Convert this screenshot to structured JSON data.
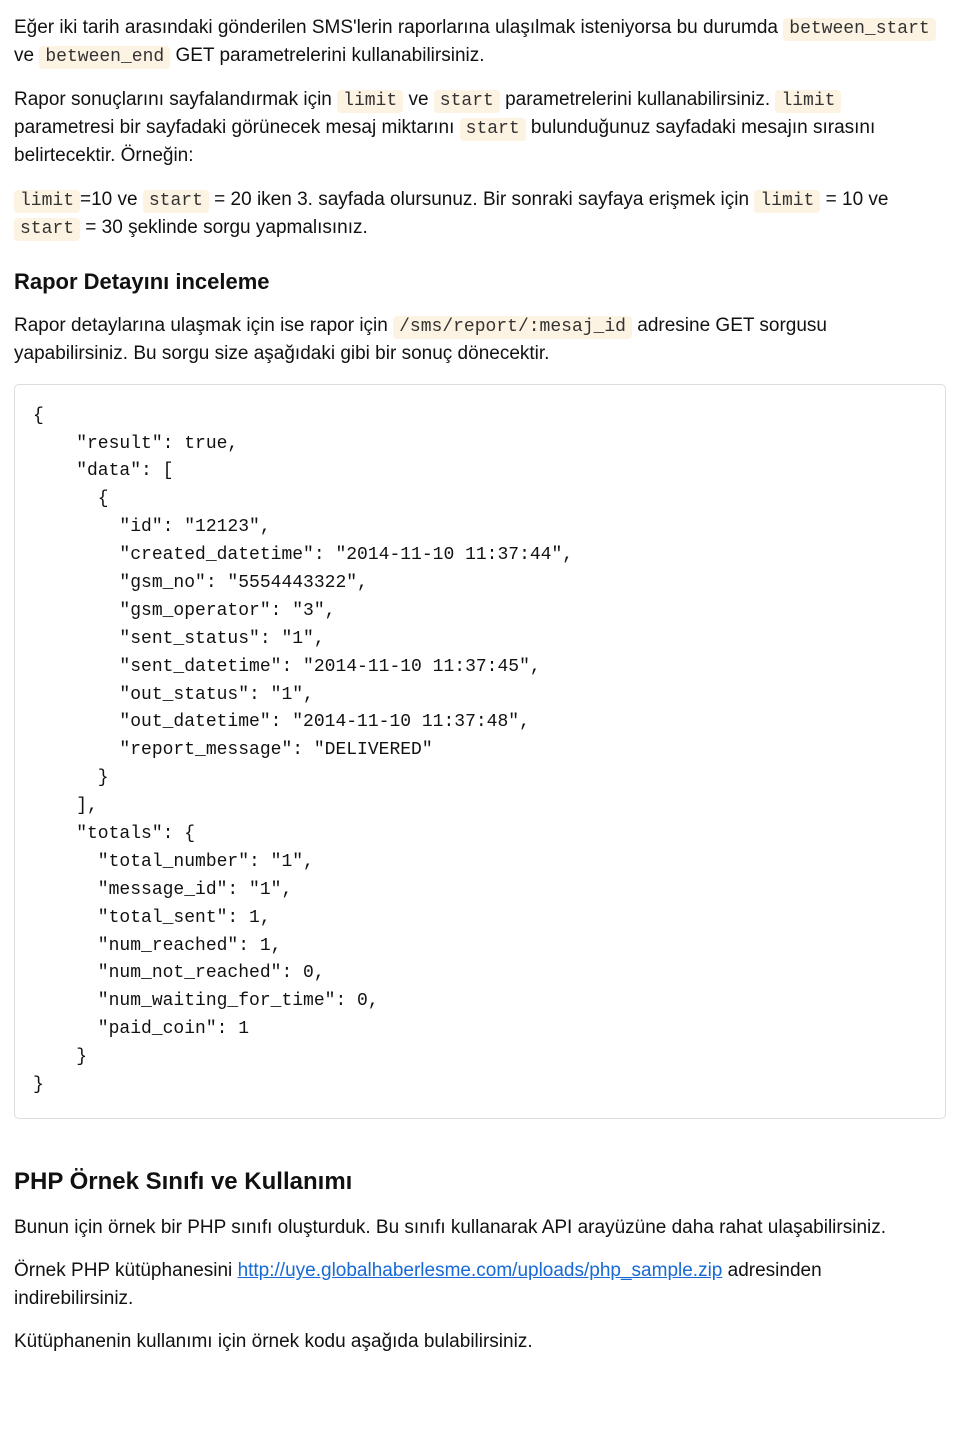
{
  "para1": {
    "t1": "Eğer iki tarih arasındaki gönderilen SMS'lerin raporlarına ulaşılmak isteniyorsa bu durumda ",
    "c1": "between_start",
    "t2": " ve ",
    "c2": "between_end",
    "t3": " GET parametrelerini kullanabilirsiniz."
  },
  "para2": {
    "t1": "Rapor sonuçlarını sayfalandırmak için ",
    "c1": "limit",
    "t2": " ve ",
    "c2": "start",
    "t3": " parametrelerini kullanabilirsiniz. ",
    "c3": "limit",
    "t4": " parametresi bir sayfadaki görünecek mesaj miktarını ",
    "c4": "start",
    "t5": " bulunduğunuz sayfadaki mesajın sırasını belirtecektir. Örneğin:"
  },
  "para3": {
    "c1": "limit",
    "t1": "=10 ve ",
    "c2": "start",
    "t2": " = 20 iken 3. sayfada olursunuz. Bir sonraki sayfaya erişmek için ",
    "c3": "limit",
    "t3": " = 10 ve ",
    "c4": "start",
    "t4": " = 30 şeklinde sorgu yapmalısınız."
  },
  "heading1": "Rapor Detayını inceleme",
  "para4": {
    "t1": "Rapor detaylarına ulaşmak için ise rapor için ",
    "c1": "/sms/report/:mesaj_id",
    "t2": " adresine GET sorgusu yapabilirsiniz. Bu sorgu size aşağıdaki gibi bir sonuç dönecektir."
  },
  "code_block": "{\n    \"result\": true,\n    \"data\": [\n      {\n        \"id\": \"12123\",\n        \"created_datetime\": \"2014-11-10 11:37:44\",\n        \"gsm_no\": \"5554443322\",\n        \"gsm_operator\": \"3\",\n        \"sent_status\": \"1\",\n        \"sent_datetime\": \"2014-11-10 11:37:45\",\n        \"out_status\": \"1\",\n        \"out_datetime\": \"2014-11-10 11:37:48\",\n        \"report_message\": \"DELIVERED\"\n      }\n    ],\n    \"totals\": {\n      \"total_number\": \"1\",\n      \"message_id\": \"1\",\n      \"total_sent\": 1,\n      \"num_reached\": 1,\n      \"num_not_reached\": 0,\n      \"num_waiting_for_time\": 0,\n      \"paid_coin\": 1\n    }\n}",
  "heading2": "PHP Örnek Sınıfı ve Kullanımı",
  "para5": "Bunun için örnek bir PHP sınıfı oluşturduk. Bu sınıfı kullanarak API arayüzüne daha rahat ulaşabilirsiniz.",
  "para6": {
    "t1": "Örnek PHP kütüphanesini ",
    "link_text": "http://uye.globalhaberlesme.com/uploads/php_sample.zip",
    "t2": " adresinden indirebilirsiniz."
  },
  "para7": "Kütüphanenin kullanımı için örnek kodu aşağıda bulabilirsiniz."
}
